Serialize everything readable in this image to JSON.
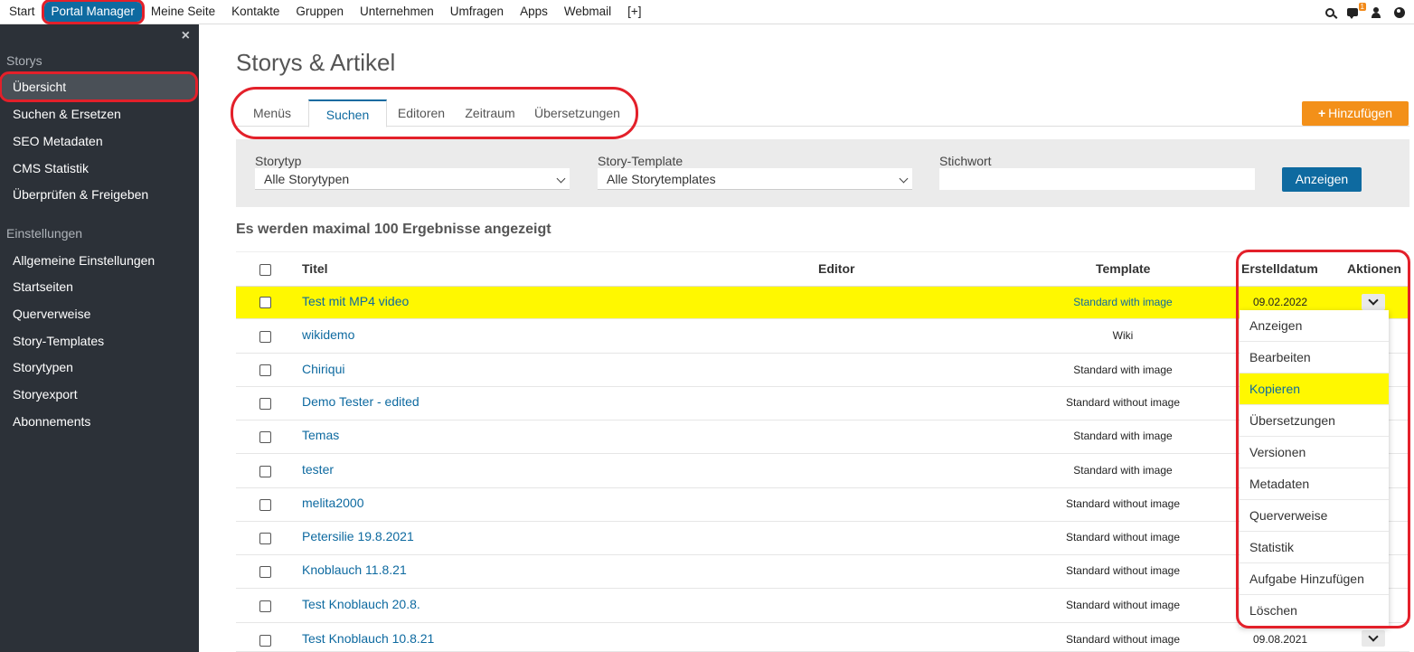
{
  "topnav": {
    "items": [
      "Start",
      "Portal Manager",
      "Meine Seite",
      "Kontakte",
      "Gruppen",
      "Unternehmen",
      "Umfragen",
      "Apps",
      "Webmail",
      "[+]"
    ],
    "notification_count": "1"
  },
  "sidebar": {
    "close": "×",
    "section1": "Storys",
    "items1": [
      "Übersicht",
      "Suchen & Ersetzen",
      "SEO Metadaten",
      "CMS Statistik",
      "Überprüfen & Freigeben"
    ],
    "section2": "Einstellungen",
    "items2": [
      "Allgemeine Einstellungen",
      "Startseiten",
      "Querverweise",
      "Story-Templates",
      "Storytypen",
      "Storyexport",
      "Abonnements"
    ]
  },
  "main": {
    "title": "Storys & Artikel",
    "tabs": [
      "Menüs",
      "Suchen",
      "Editoren",
      "Zeitraum",
      "Übersetzungen"
    ],
    "add_button": "Hinzufügen",
    "add_plus": "+"
  },
  "filter": {
    "storytyp_label": "Storytyp",
    "storytyp_value": "Alle Storytypen",
    "template_label": "Story-Template",
    "template_value": "Alle Storytemplates",
    "stichwort_label": "Stichwort",
    "show_button": "Anzeigen"
  },
  "results_note": "Es werden maximal 100 Ergebnisse angezeigt",
  "table": {
    "headers": {
      "title": "Titel",
      "editor": "Editor",
      "template": "Template",
      "date": "Erstelldatum",
      "actions": "Aktionen"
    },
    "rows": [
      {
        "title": "Test mit MP4 video",
        "template": "Standard with image",
        "date": "09.02.2022"
      },
      {
        "title": "wikidemo",
        "template": "Wiki",
        "date": ""
      },
      {
        "title": "Chiriqui",
        "template": "Standard with image",
        "date": ""
      },
      {
        "title": "Demo Tester - edited",
        "template": "Standard without image",
        "date": ""
      },
      {
        "title": "Temas",
        "template": "Standard with image",
        "date": ""
      },
      {
        "title": "tester",
        "template": "Standard with image",
        "date": ""
      },
      {
        "title": "melita2000",
        "template": "Standard without image",
        "date": ""
      },
      {
        "title": "Petersilie 19.8.2021",
        "template": "Standard without image",
        "date": ""
      },
      {
        "title": "Knoblauch 11.8.21",
        "template": "Standard without image",
        "date": ""
      },
      {
        "title": "Test Knoblauch 20.8.",
        "template": "Standard without image",
        "date": ""
      },
      {
        "title": "Test Knoblauch 10.8.21",
        "template": "Standard without image",
        "date": "09.08.2021"
      }
    ]
  },
  "actions_menu": [
    "Anzeigen",
    "Bearbeiten",
    "Kopieren",
    "Übersetzungen",
    "Versionen",
    "Metadaten",
    "Querverweise",
    "Statistik",
    "Aufgabe Hinzufügen",
    "Löschen"
  ],
  "colors": {
    "primary": "#0e6aa0",
    "accent": "#f39019",
    "highlight": "#fff800",
    "annotation": "#e3202a",
    "sidebar": "#2c3138"
  }
}
